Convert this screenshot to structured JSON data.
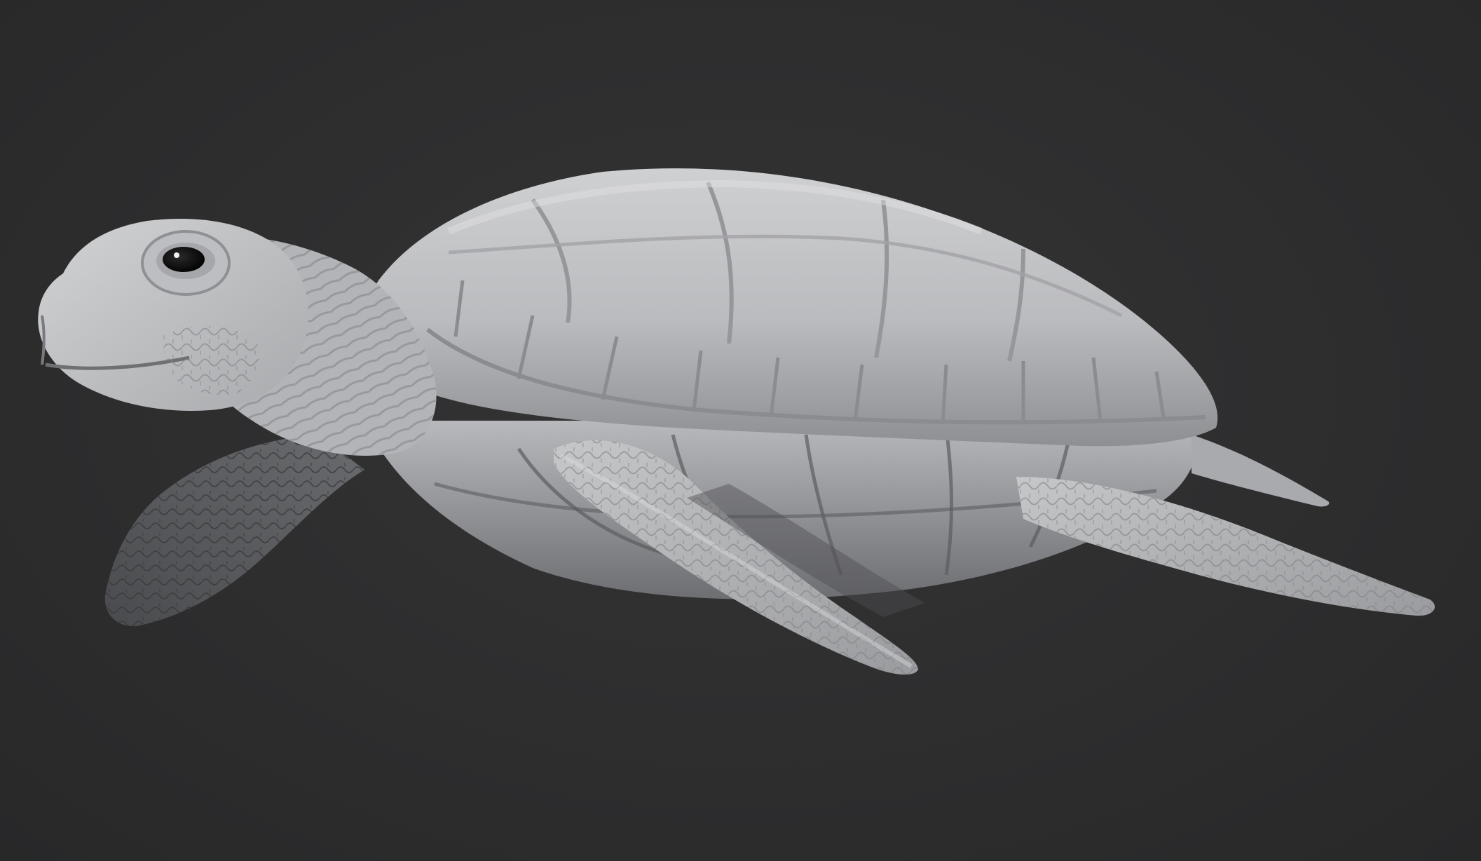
{
  "viewport": {
    "background_color": "#2e2e2f",
    "subject": "sculpted-sea-turtle-model",
    "material_color": "#bfc0c2",
    "shadow_color": "#5a5b5e",
    "eye_color": "#111111"
  }
}
